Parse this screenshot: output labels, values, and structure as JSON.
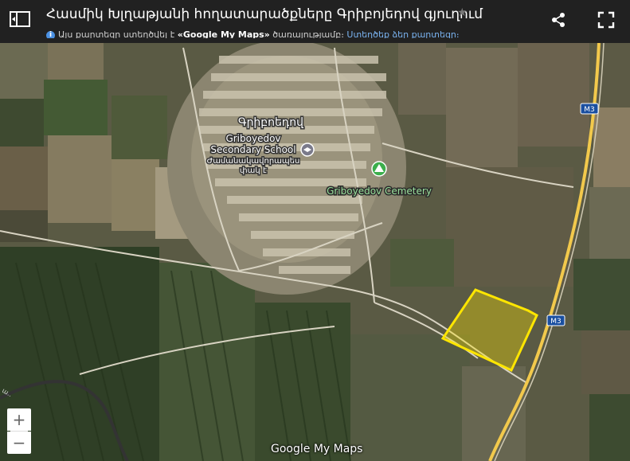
{
  "header": {
    "title": "Հասմիկ Խլղաթյանի հողատարածքները Գրիբոյեդով գյուղում",
    "info_prefix": "Այս քարտեզը ստեղծվել է",
    "info_bold": "«Google My Maps»",
    "info_middle": "ծառայությամբ։",
    "info_link": "Ստեղծեք ձեր քարտեզը։"
  },
  "controls": {
    "zoom_in": "+",
    "zoom_out": "−"
  },
  "icons": {
    "sidebar": "sidebar-toggle-icon",
    "star": "star-icon",
    "share": "share-icon",
    "fullscreen": "fullscreen-icon",
    "school": "school-pin-icon",
    "cemetery": "cemetery-pin-icon",
    "info": "info-icon"
  },
  "map": {
    "village_label": "Գրիբոեդով",
    "school_label_en1": "Griboyedov",
    "school_label_en2": "Secondary School",
    "school_label_hy1": "Ժամանակավորապես",
    "school_label_hy2": "փակ է",
    "cemetery_label": "Griboyedov Cemetery",
    "road_shield_1": "M3",
    "road_shield_2": "M3",
    "edge_text": "ա..",
    "highlight_color": "#ffe600",
    "brand": "Google My Maps"
  }
}
